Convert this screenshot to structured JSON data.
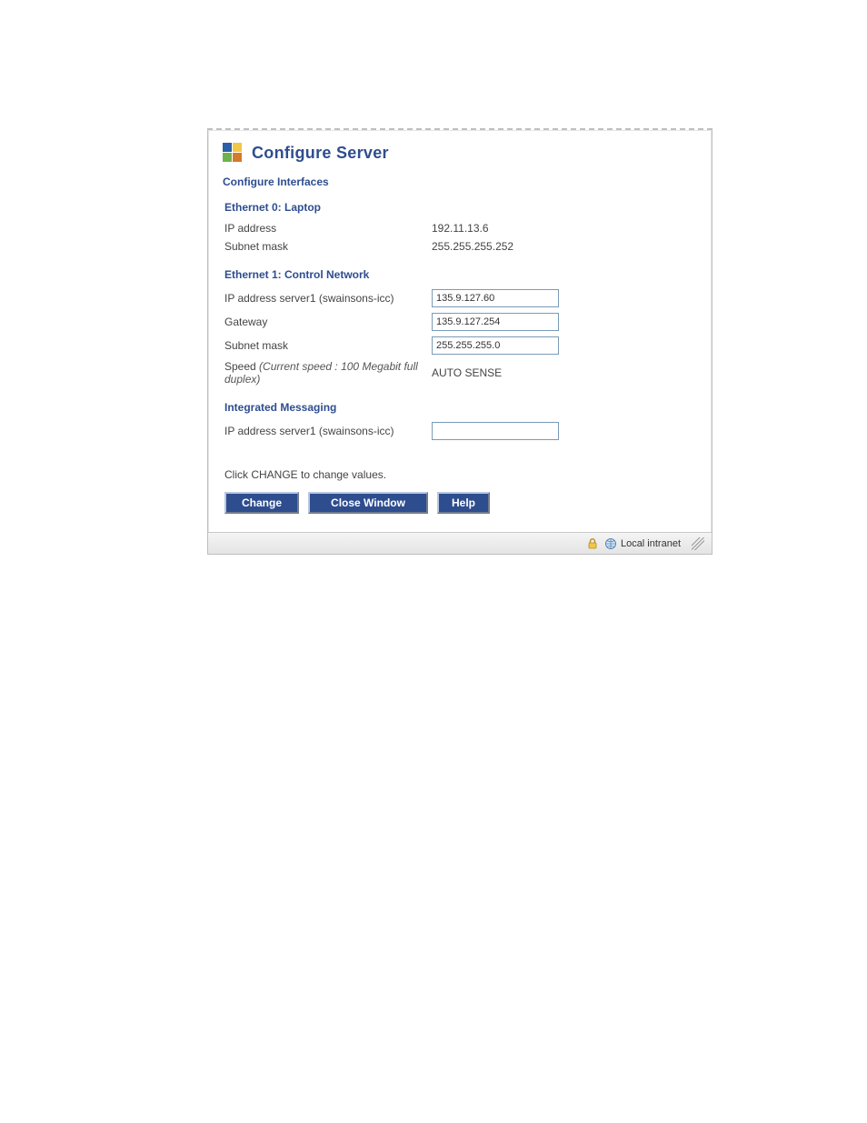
{
  "header": {
    "title": "Configure Server",
    "subsection": "Configure Interfaces"
  },
  "eth0": {
    "title": "Ethernet 0: Laptop",
    "ip_label": "IP address",
    "ip_value": "192.11.13.6",
    "mask_label": "Subnet mask",
    "mask_value": "255.255.255.252"
  },
  "eth1": {
    "title": "Ethernet 1: Control Network",
    "ip_label": "IP address server1 (swainsons-icc)",
    "ip_value": "135.9.127.60",
    "gw_label": "Gateway",
    "gw_value": "135.9.127.254",
    "mask_label": "Subnet mask",
    "mask_value": "255.255.255.0",
    "speed_label": "Speed ",
    "speed_note": "(Current speed : 100 Megabit full duplex)",
    "speed_value": "AUTO SENSE"
  },
  "im": {
    "title": "Integrated Messaging",
    "ip_label": "IP address server1 (swainsons-icc)",
    "ip_value": ""
  },
  "instruction": "Click CHANGE to change values.",
  "buttons": {
    "change": "Change",
    "close": "Close Window",
    "help": "Help"
  },
  "statusbar": {
    "zone": "Local intranet"
  }
}
